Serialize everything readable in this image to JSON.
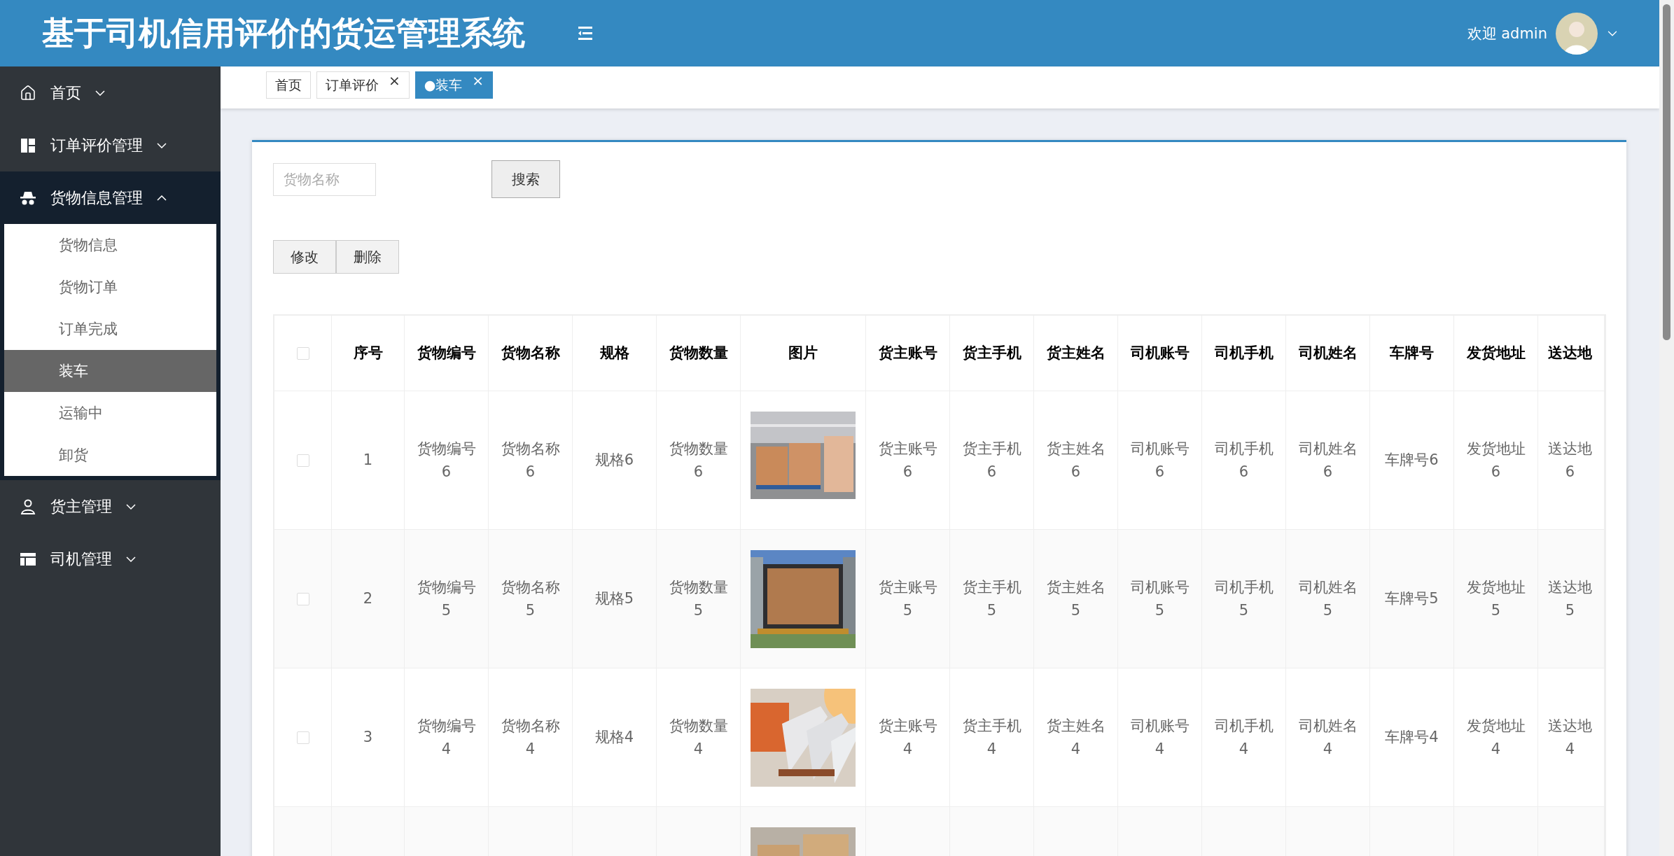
{
  "header": {
    "title": "基于司机信用评价的货运管理系统",
    "welcome": "欢迎 admin"
  },
  "sidebar": {
    "items": [
      {
        "label": "首页",
        "expanded": false
      },
      {
        "label": "订单评价管理",
        "expanded": false
      },
      {
        "label": "货物信息管理",
        "expanded": true,
        "children": [
          {
            "label": "货物信息",
            "selected": false
          },
          {
            "label": "货物订单",
            "selected": false
          },
          {
            "label": "订单完成",
            "selected": false
          },
          {
            "label": "装车",
            "selected": true
          },
          {
            "label": "运输中",
            "selected": false
          },
          {
            "label": "卸货",
            "selected": false
          }
        ]
      },
      {
        "label": "货主管理",
        "expanded": false
      },
      {
        "label": "司机管理",
        "expanded": false
      }
    ]
  },
  "tabs": [
    {
      "label": "首页",
      "selected": false
    },
    {
      "label": "订单评价",
      "selected": false,
      "close": "×"
    },
    {
      "label": "●装车",
      "selected": true,
      "close": "×"
    }
  ],
  "search": {
    "placeholder": "货物名称",
    "button": "搜索"
  },
  "actions": [
    "修改",
    "删除"
  ],
  "table": {
    "all_checked": false,
    "columns": [
      {
        "label": "序号",
        "kind": "text"
      },
      {
        "label": "货物编号",
        "kind": "text"
      },
      {
        "label": "货物名称",
        "kind": "text"
      },
      {
        "label": "规格",
        "kind": "text"
      },
      {
        "label": "货物数量",
        "kind": "text"
      },
      {
        "label": "图片"
      },
      {
        "label": "货主账号",
        "kind": "text"
      },
      {
        "label": "货主手机",
        "kind": "text"
      },
      {
        "label": "货主姓名",
        "kind": "text"
      },
      {
        "label": "司机账号",
        "kind": "text"
      },
      {
        "label": "司机手机",
        "kind": "text"
      },
      {
        "label": "司机姓名",
        "kind": "text"
      },
      {
        "label": "车牌号",
        "kind": "text"
      },
      {
        "label": "发货地址",
        "kind": "text"
      },
      {
        "label": "送达地",
        "kind": "text"
      }
    ],
    "rows": [
      {
        "checked": false,
        "cells": [
          "1",
          "货物编号6",
          "货物名称6",
          "规格6",
          "货物数量6",
          "货主账号6",
          "货主手机6",
          "货主姓名6",
          "司机账号6",
          "司机手机6",
          "司机姓名6",
          "车牌号6",
          "发货地址6",
          "送达地\n6"
        ],
        "image": {
          "kind": "picture"
        }
      },
      {
        "checked": false,
        "cells": [
          "2",
          "货物编号5",
          "货物名称5",
          "规格5",
          "货物数量5",
          "货主账号5",
          "货主手机5",
          "货主姓名5",
          "司机账号5",
          "司机手机5",
          "司机姓名5",
          "车牌号5",
          "发货地址5",
          "送达地\n5"
        ],
        "image": {
          "kind": "picture"
        }
      },
      {
        "checked": false,
        "cells": [
          "3",
          "货物编号4",
          "货物名称4",
          "规格4",
          "货物数量4",
          "货主账号4",
          "货主手机4",
          "货主姓名4",
          "司机账号4",
          "司机手机4",
          "司机姓名4",
          "车牌号4",
          "发货地址4",
          "送达地\n4"
        ],
        "image": {
          "kind": "picture"
        }
      },
      {
        "image": {
          "kind": "picture"
        }
      }
    ]
  }
}
